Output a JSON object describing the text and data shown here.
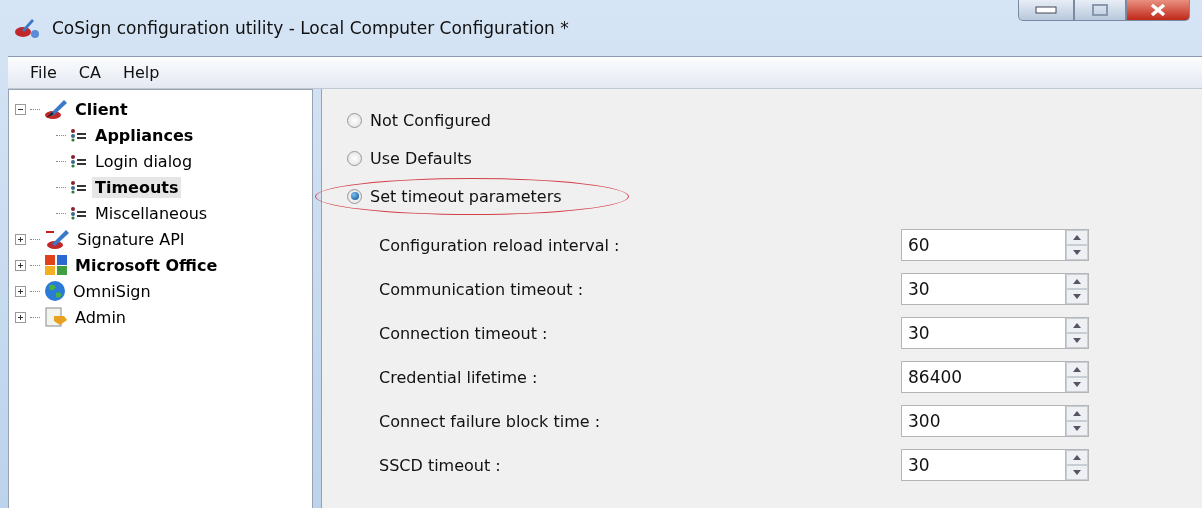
{
  "window": {
    "title": "CoSign configuration utility - Local Computer Configuration *"
  },
  "menu": [
    "File",
    "CA",
    "Help"
  ],
  "tree": [
    {
      "label": "Client",
      "kind": "pen",
      "configured": true,
      "selected": false,
      "expanded": true,
      "children": [
        {
          "label": "Appliances",
          "kind": "list",
          "configured": true,
          "selected": false
        },
        {
          "label": "Login dialog",
          "kind": "list",
          "configured": false,
          "selected": false
        },
        {
          "label": "Timeouts",
          "kind": "list",
          "configured": true,
          "selected": true
        },
        {
          "label": "Miscellaneous",
          "kind": "list",
          "configured": false,
          "selected": false
        }
      ]
    },
    {
      "label": "Signature API",
      "kind": "api",
      "configured": false,
      "selected": false,
      "expanded": false
    },
    {
      "label": "Microsoft Office",
      "kind": "office",
      "configured": true,
      "selected": false,
      "expanded": false
    },
    {
      "label": "OmniSign",
      "kind": "globe",
      "configured": false,
      "selected": false,
      "expanded": false
    },
    {
      "label": "Admin",
      "kind": "admin",
      "configured": false,
      "selected": false,
      "expanded": false
    }
  ],
  "options": [
    {
      "label": "Not Configured",
      "selected": false,
      "highlighted": false
    },
    {
      "label": "Use Defaults",
      "selected": false,
      "highlighted": false
    },
    {
      "label": "Set timeout parameters",
      "selected": true,
      "highlighted": true
    }
  ],
  "parameters": [
    {
      "label": "Configuration reload interval :",
      "value": "60"
    },
    {
      "label": "Communication timeout :",
      "value": "30"
    },
    {
      "label": "Connection timeout :",
      "value": "30"
    },
    {
      "label": "Credential lifetime :",
      "value": "86400"
    },
    {
      "label": "Connect failure block time :",
      "value": "300"
    },
    {
      "label": "SSCD timeout :",
      "value": "30"
    }
  ]
}
